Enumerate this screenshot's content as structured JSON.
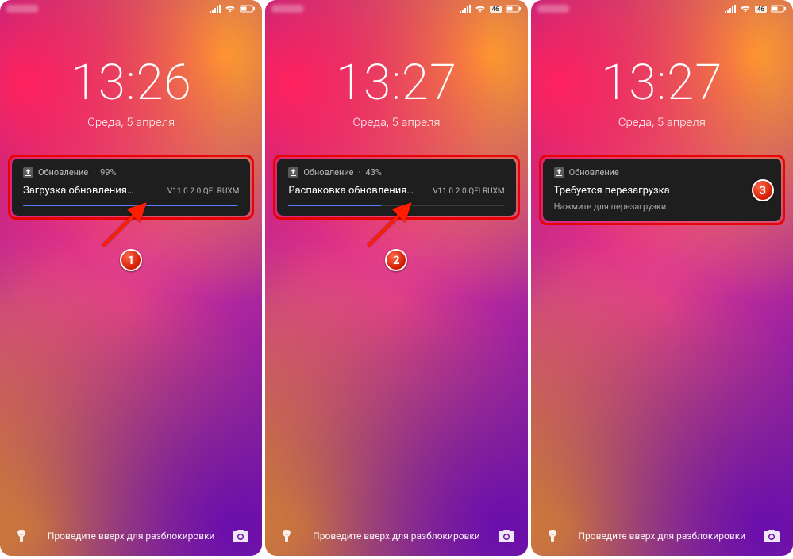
{
  "screens": [
    {
      "time": "13:26",
      "date": "Среда, 5 апреля",
      "status": {
        "battery_label": ""
      },
      "notif": {
        "app": "Обновление",
        "percent": "99%",
        "title": "Загрузка обновления…",
        "version": "V11.0.2.0.QFLRUXM",
        "progress": 99,
        "subtitle": null
      },
      "step": "1",
      "unlock": "Проведите вверх для разблокировки"
    },
    {
      "time": "13:27",
      "date": "Среда, 5 апреля",
      "status": {
        "battery_label": "46"
      },
      "notif": {
        "app": "Обновление",
        "percent": "43%",
        "title": "Распаковка обновления…",
        "version": "V11.0.2.0.QFLRUXM",
        "progress": 43,
        "subtitle": null
      },
      "step": "2",
      "unlock": "Проведите вверх для разблокировки"
    },
    {
      "time": "13:27",
      "date": "Среда, 5 апреля",
      "status": {
        "battery_label": "46"
      },
      "notif": {
        "app": "Обновление",
        "percent": null,
        "title": "Требуется перезагрузка",
        "version": null,
        "progress": null,
        "subtitle": "Нажмите для перезагрузки."
      },
      "step": "3",
      "unlock": "Проведите вверх для разблокировки"
    }
  ]
}
